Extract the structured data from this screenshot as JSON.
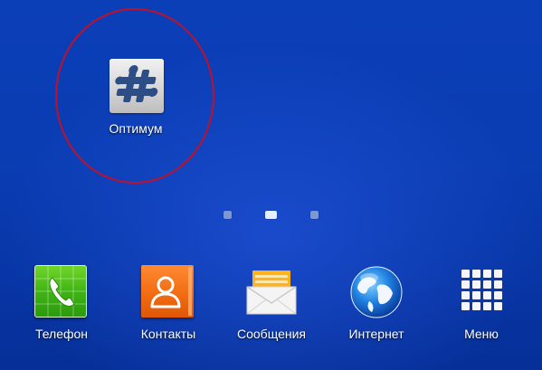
{
  "home": {
    "highlighted_app": {
      "label": "Оптимум",
      "icon": "puzzle-hash-icon"
    },
    "page_indicator": {
      "pages": 3,
      "active_index": 1
    },
    "dock": [
      {
        "label": "Телефон",
        "icon": "phone-icon"
      },
      {
        "label": "Контакты",
        "icon": "contacts-icon"
      },
      {
        "label": "Сообщения",
        "icon": "envelope-icon"
      },
      {
        "label": "Интернет",
        "icon": "globe-icon"
      },
      {
        "label": "Меню",
        "icon": "app-grid-icon"
      }
    ]
  },
  "colors": {
    "wallpaper": "#0a3cb2",
    "highlight_ring": "#c0102a",
    "phone_green": "#3fb415",
    "contacts_orange": "#f06a10"
  }
}
